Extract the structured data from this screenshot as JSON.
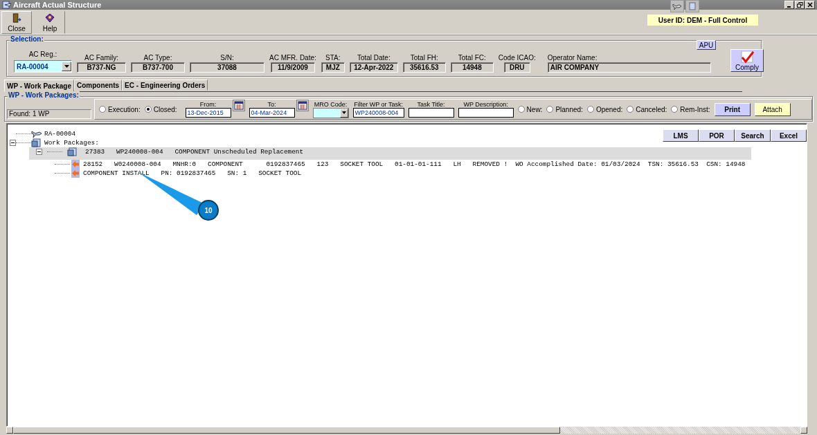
{
  "window": {
    "title": "Aircraft Actual Structure"
  },
  "toolbar": [
    {
      "label": "Close",
      "kind": "close"
    },
    {
      "label": "Help",
      "kind": "help"
    }
  ],
  "user_badge": "User ID: DEM - Full Control",
  "selection": {
    "legend": "Selection:",
    "fields": [
      {
        "label": "AC Reg.:",
        "value": "RA-00004",
        "kind": "combo"
      },
      {
        "label": "AC Family:",
        "value": "B737-NG",
        "kind": "text"
      },
      {
        "label": "AC Type:",
        "value": "B737-700",
        "kind": "text"
      },
      {
        "label": "S/N:",
        "value": "37088",
        "kind": "text"
      },
      {
        "label": "AC MFR. Date:",
        "value": "11/9/2009",
        "kind": "text"
      },
      {
        "label": "STA:",
        "value": "MJZ",
        "kind": "text"
      },
      {
        "label": "Total Date:",
        "value": "12-Apr-2022",
        "kind": "text"
      },
      {
        "label": "Total FH:",
        "value": "35616.53",
        "kind": "text"
      },
      {
        "label": "Total FC:",
        "value": "14948",
        "kind": "text"
      },
      {
        "label": "Code ICAO:",
        "value": "DRU",
        "kind": "text"
      },
      {
        "label": "Operator Name:",
        "value": "AIR COMPANY",
        "kind": "wide"
      }
    ],
    "apu_button": "APU",
    "comply_button": "Comply"
  },
  "tabs": [
    {
      "label": "WP - Work Package",
      "selected": true
    },
    {
      "label": "Components",
      "selected": false
    },
    {
      "label": "EC - Engineering Orders",
      "selected": false
    }
  ],
  "work_packages": {
    "legend": "WP - Work Packages:",
    "found": "Found: 1 WP",
    "mode_radios": [
      {
        "label": "Execution:",
        "selected": false
      },
      {
        "label": "Closed:",
        "selected": true
      }
    ],
    "from": {
      "label": "From:",
      "value": "13-Dec-2015"
    },
    "to": {
      "label": "To:",
      "value": "04-Mar-2024"
    },
    "mro_code": {
      "label": "MRO Code:"
    },
    "filter": {
      "label": "Filter WP or Task:",
      "value": "WP240008-004"
    },
    "task_title": {
      "label": "Task Title:"
    },
    "wp_description": {
      "label": "WP Description:"
    },
    "state_radios": [
      {
        "label": "New:",
        "selected": false
      },
      {
        "label": "Planned:",
        "selected": false
      },
      {
        "label": "Opened:",
        "selected": false
      },
      {
        "label": "Canceled:",
        "selected": false
      },
      {
        "label": "Rem-Inst:",
        "selected": false
      }
    ],
    "buttons": [
      {
        "label": "Print",
        "kind": "print"
      },
      {
        "label": "Attach",
        "kind": "attach"
      }
    ]
  },
  "tree": {
    "buttons": [
      "LMS",
      "POR",
      "Search",
      "Excel"
    ],
    "nodes": [
      {
        "text": "RA-00004",
        "kind": "aircraft",
        "selected": false
      },
      {
        "text": "Work Packages:",
        "kind": "folder",
        "selected": false,
        "expanded": true,
        "children": [
          {
            "text": "27383   WP240008-004   COMPONENT Unscheduled Replacement",
            "kind": "package",
            "selected": true,
            "expanded": true,
            "children": [
              {
                "text": "28152   W0240008-004   MNHR:0   COMPONENT      0192837465   123   SOCKET TOOL   01-01-01-111   LH   REMOVED !  WO Accomplished Date: 01/03/2024  TSN: 35616.53  CSN: 14948",
                "kind": "task",
                "selected": false
              },
              {
                "text": "COMPONENT INSTALL   PN: 0192837465   SN: 1   SOCKET TOOL",
                "kind": "task",
                "selected": false
              }
            ]
          }
        ]
      }
    ]
  },
  "callout": {
    "label": "10"
  }
}
